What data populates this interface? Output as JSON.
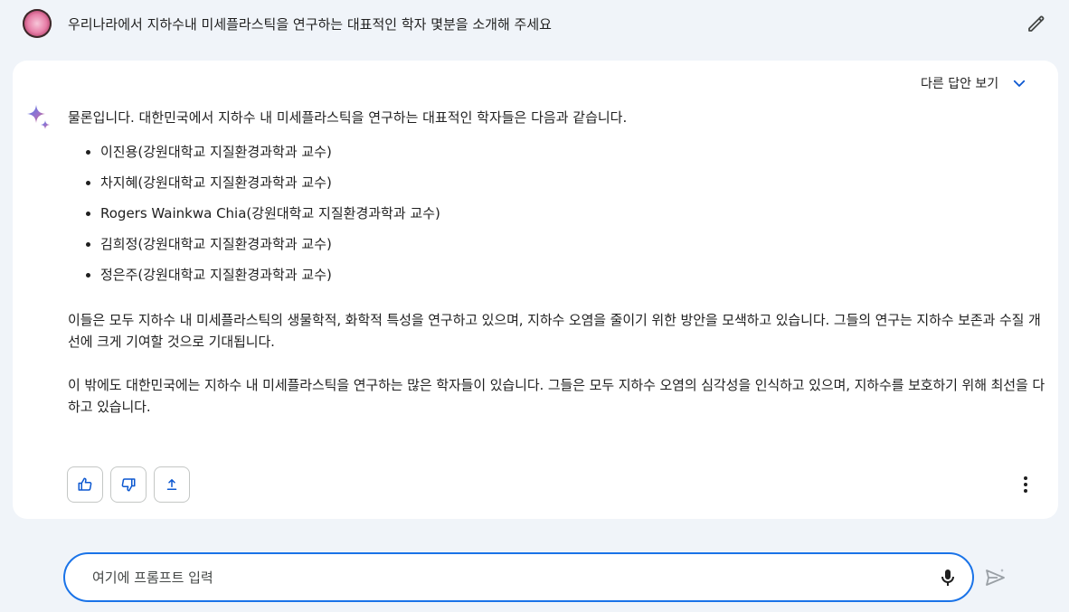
{
  "user": {
    "query": "우리나라에서 지하수내 미세플라스틱을 연구하는 대표적인 학자 몇분을 소개해 주세요"
  },
  "response": {
    "drafts_label": "다른 답안 보기",
    "intro": "물론입니다. 대한민국에서 지하수 내 미세플라스틱을 연구하는 대표적인 학자들은 다음과 같습니다.",
    "researchers": [
      "이진용(강원대학교 지질환경과학과 교수)",
      "차지혜(강원대학교 지질환경과학과 교수)",
      "Rogers Wainkwa Chia(강원대학교 지질환경과학과 교수)",
      "김희정(강원대학교 지질환경과학과 교수)",
      "정은주(강원대학교 지질환경과학과 교수)"
    ],
    "paragraph1": "이들은 모두 지하수 내 미세플라스틱의 생물학적, 화학적 특성을 연구하고 있으며, 지하수 오염을 줄이기 위한 방안을 모색하고 있습니다. 그들의 연구는 지하수 보존과 수질 개선에 크게 기여할 것으로 기대됩니다.",
    "paragraph2": "이 밖에도 대한민국에는 지하수 내 미세플라스틱을 연구하는 많은 학자들이 있습니다. 그들은 모두 지하수 오염의 심각성을 인식하고 있으며, 지하수를 보호하기 위해 최선을 다하고 있습니다."
  },
  "input": {
    "placeholder": "여기에 프롬프트 입력",
    "value": ""
  },
  "icons": {
    "edit": "pencil-icon",
    "drafts": "chevron-down-icon",
    "assistant": "sparkle-icon",
    "like": "thumbs-up-icon",
    "dislike": "thumbs-down-icon",
    "share": "share-icon",
    "more": "more-vert-icon",
    "mic": "microphone-icon",
    "send": "send-icon"
  },
  "colors": {
    "background": "#f0f4f9",
    "card": "#ffffff",
    "accent": "#1a73e8",
    "action_icon": "#0b57d0"
  }
}
